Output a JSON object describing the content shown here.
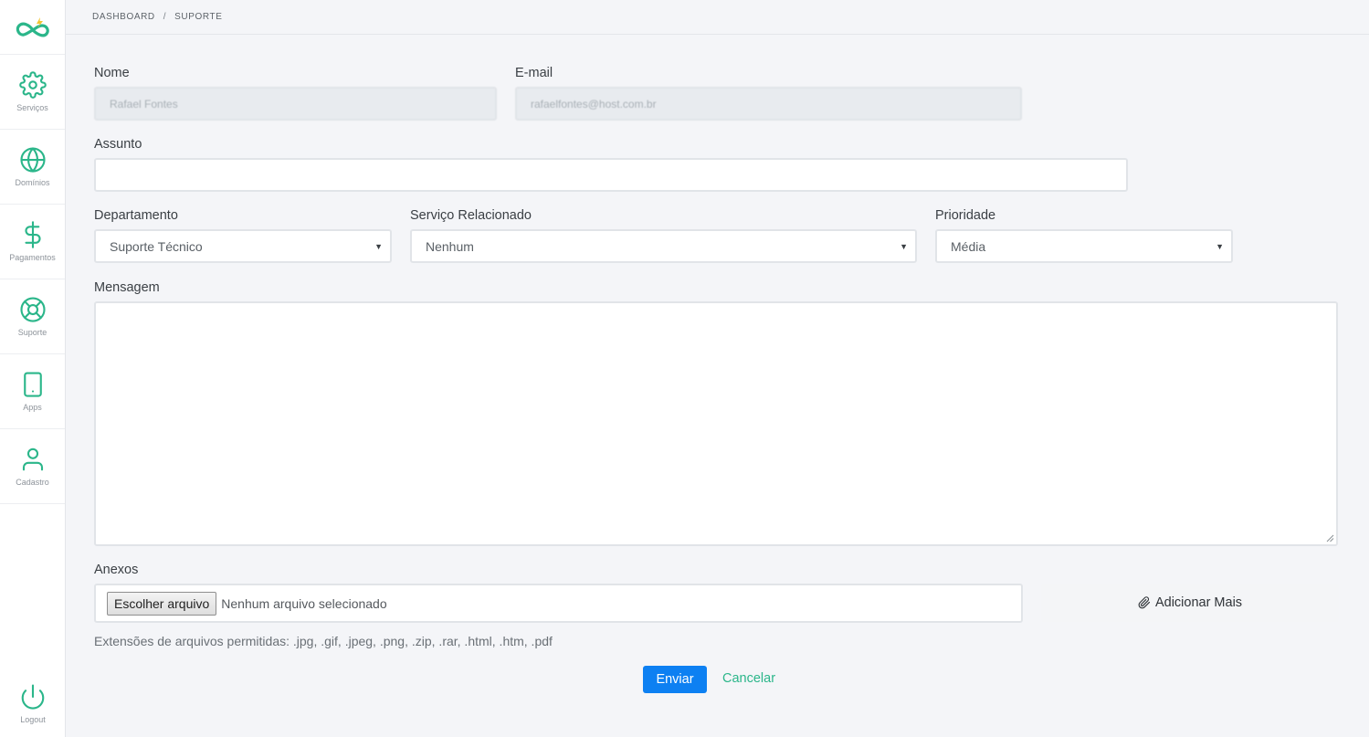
{
  "breadcrumb": {
    "items": [
      "DASHBOARD",
      "SUPORTE"
    ],
    "separator": "/"
  },
  "sidebar": {
    "items": [
      {
        "label": "Serviços",
        "icon": "gear-icon"
      },
      {
        "label": "Domínios",
        "icon": "globe-icon"
      },
      {
        "label": "Pagamentos",
        "icon": "dollar-icon"
      },
      {
        "label": "Suporte",
        "icon": "lifebuoy-icon"
      },
      {
        "label": "Apps",
        "icon": "phone-icon"
      },
      {
        "label": "Cadastro",
        "icon": "user-icon"
      }
    ],
    "logout": {
      "label": "Logout",
      "icon": "power-icon"
    }
  },
  "form": {
    "name": {
      "label": "Nome",
      "value": "Rafael Fontes"
    },
    "email": {
      "label": "E-mail",
      "value": "rafaelfontes@host.com.br"
    },
    "subject": {
      "label": "Assunto",
      "value": ""
    },
    "department": {
      "label": "Departamento",
      "value": "Suporte Técnico"
    },
    "service": {
      "label": "Serviço Relacionado",
      "value": "Nenhum"
    },
    "priority": {
      "label": "Prioridade",
      "value": "Média"
    },
    "message": {
      "label": "Mensagem",
      "value": ""
    },
    "attachments": {
      "label": "Anexos",
      "button_label": "Escolher arquivo",
      "status": "Nenhum arquivo selecionado",
      "add_more_label": "Adicionar Mais",
      "hint": "Extensões de arquivos permitidas: .jpg, .gif, .jpeg, .png, .zip, .rar, .html, .htm, .pdf"
    },
    "submit_label": "Enviar",
    "cancel_label": "Cancelar"
  },
  "colors": {
    "accent": "#2bb68a",
    "primary_button": "#0d80f2"
  }
}
